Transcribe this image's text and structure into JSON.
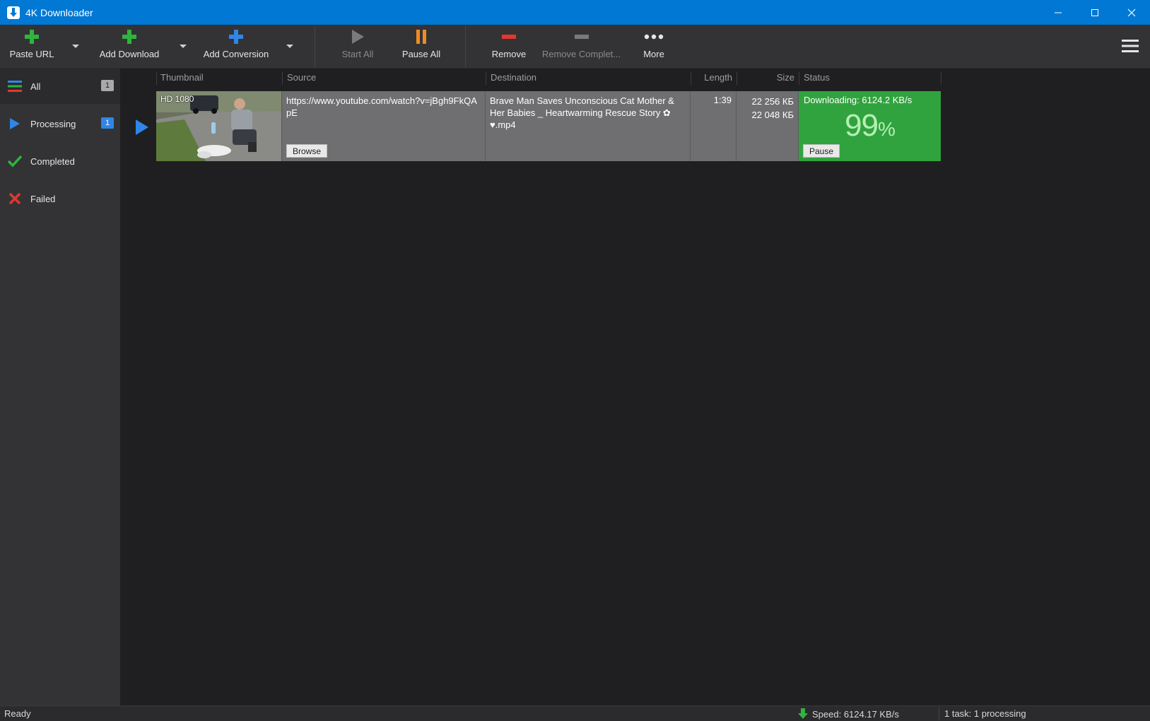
{
  "window": {
    "title": "4K Downloader"
  },
  "toolbar": {
    "paste_url": "Paste URL",
    "add_download": "Add Download",
    "add_conversion": "Add Conversion",
    "start_all": "Start All",
    "pause_all": "Pause All",
    "remove": "Remove",
    "remove_completed": "Remove Complet...",
    "more": "More"
  },
  "sidebar": {
    "items": [
      {
        "label": "All",
        "badge": "1",
        "icon": "list-icon"
      },
      {
        "label": "Processing",
        "badge": "1",
        "icon": "play-icon"
      },
      {
        "label": "Completed",
        "icon": "check-icon"
      },
      {
        "label": "Failed",
        "icon": "x-icon"
      }
    ]
  },
  "columns": {
    "thumbnail": "Thumbnail",
    "source": "Source",
    "destination": "Destination",
    "length": "Length",
    "size": "Size",
    "status": "Status"
  },
  "download": {
    "quality": "HD 1080",
    "source_url": "https://www.youtube.com/watch?v=jBgh9FkQApE",
    "browse_label": "Browse",
    "destination": "Brave Man Saves Unconscious Cat Mother & Her Babies _ Heartwarming Rescue Story ✿ ♥.mp4",
    "length": "1:39",
    "size_total": "22 256 КБ",
    "size_done": "22 048 КБ",
    "status_text": "Downloading: 6124.2 KB/s",
    "percent": "99",
    "percent_sign": "%",
    "progress": 0.99,
    "pause_label": "Pause"
  },
  "statusbar": {
    "ready": "Ready",
    "speed": "Speed: 6124.17 KB/s",
    "tasks": "1 task: 1 processing"
  },
  "colors": {
    "titlebar": "#0078d4",
    "status_green": "#31a33e",
    "add_green": "#2fb43d",
    "accent_blue": "#2f86e8",
    "pause_orange": "#f08a24",
    "remove_red": "#e0382f"
  }
}
